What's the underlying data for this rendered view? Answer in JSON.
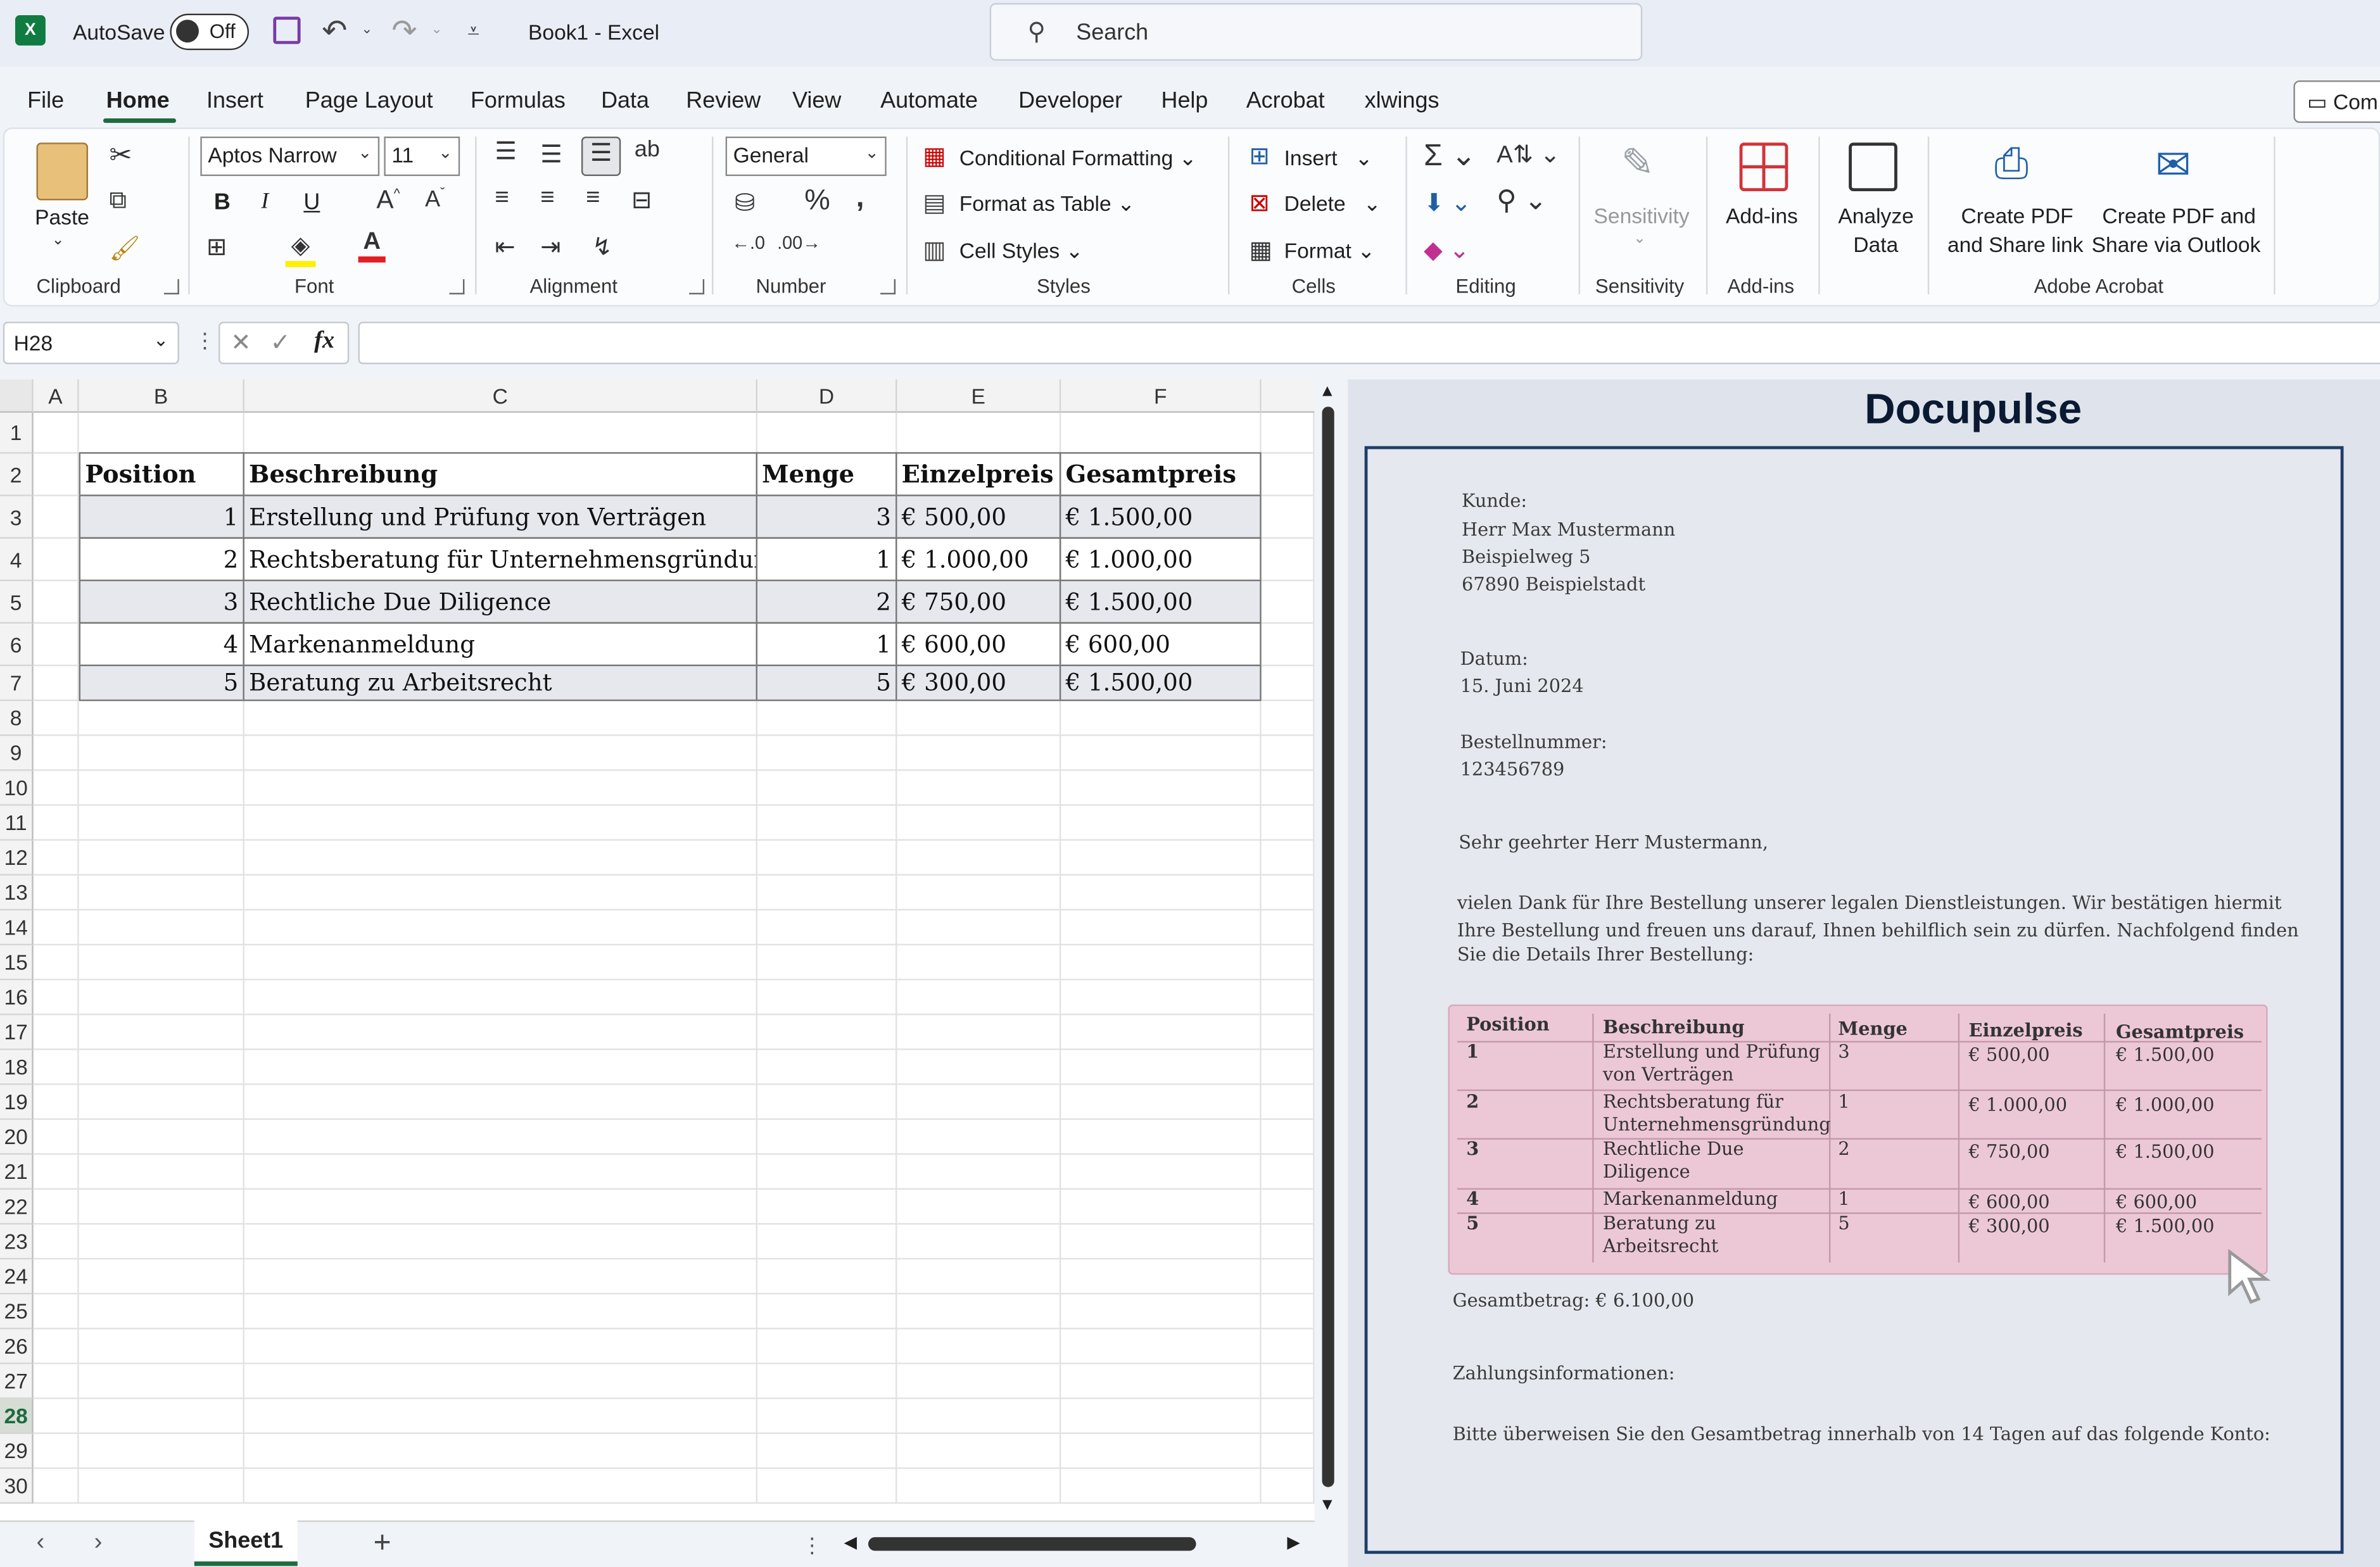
{
  "window": {
    "title": "Book1  -  Excel",
    "autosave_label": "AutoSave",
    "autosave_state": "Off",
    "search_placeholder": "Search"
  },
  "menu": [
    "File",
    "Home",
    "Insert",
    "Page Layout",
    "Formulas",
    "Data",
    "Review",
    "View",
    "Automate",
    "Developer",
    "Help",
    "Acrobat",
    "xlwings"
  ],
  "comments_button": "Com",
  "ribbon": {
    "clipboard": {
      "paste": "Paste",
      "label": "Clipboard"
    },
    "font": {
      "name": "Aptos Narrow",
      "size": "11",
      "label": "Font",
      "bold": "B",
      "italic": "I",
      "underline": "U"
    },
    "alignment": {
      "label": "Alignment"
    },
    "number": {
      "format": "General",
      "label": "Number"
    },
    "styles": {
      "conditional": "Conditional Formatting",
      "table": "Format as Table",
      "cell_styles": "Cell Styles",
      "label": "Styles"
    },
    "cells": {
      "insert": "Insert",
      "delete": "Delete",
      "format": "Format",
      "label": "Cells"
    },
    "editing": {
      "label": "Editing"
    },
    "sensitivity": {
      "button": "Sensitivity",
      "label": "Sensitivity"
    },
    "addins": {
      "button": "Add-ins",
      "label": "Add-ins"
    },
    "analyze": {
      "line1": "Analyze",
      "line2": "Data"
    },
    "acrobat": {
      "pdf1_line1": "Create PDF",
      "pdf1_line2": "and Share link",
      "pdf2_line1": "Create PDF and",
      "pdf2_line2": "Share via Outlook",
      "label": "Adobe Acrobat"
    }
  },
  "formula_bar": {
    "name_box": "H28",
    "fx": "fx",
    "content": ""
  },
  "sheet": {
    "columns": [
      "A",
      "B",
      "C",
      "D",
      "E",
      "F"
    ],
    "rows": [
      "1",
      "2",
      "3",
      "4",
      "5",
      "6",
      "7",
      "8",
      "9",
      "10",
      "11",
      "12",
      "13",
      "14",
      "15",
      "16",
      "17",
      "18",
      "19",
      "20",
      "21",
      "22",
      "23",
      "24",
      "25",
      "26",
      "27",
      "28",
      "29",
      "30"
    ],
    "selected_row": "28",
    "table": {
      "headers": [
        "Position",
        "Beschreibung",
        "Menge",
        "Einzelpreis",
        "Gesamtpreis"
      ],
      "rows": [
        [
          "1",
          "Erstellung und Prüfung von Verträgen",
          "3",
          "€ 500,00",
          "€ 1.500,00"
        ],
        [
          "2",
          "Rechtsberatung für Unternehmensgründung",
          "1",
          "€ 1.000,00",
          "€ 1.000,00"
        ],
        [
          "3",
          "Rechtliche Due Diligence",
          "2",
          "€ 750,00",
          "€ 1.500,00"
        ],
        [
          "4",
          "Markenanmeldung",
          "1",
          "€ 600,00",
          "€ 600,00"
        ],
        [
          "5",
          "Beratung zu Arbeitsrecht",
          "5",
          "€ 300,00",
          "€ 1.500,00"
        ]
      ]
    },
    "tab": "Sheet1"
  },
  "preview": {
    "title": "Docupulse",
    "kunde_label": "Kunde:",
    "kunde": [
      "Herr Max Mustermann",
      "Beispielweg 5",
      "67890 Beispielstadt"
    ],
    "datum_label": "Datum:",
    "datum": "15. Juni 2024",
    "bestell_label": "Bestellnummer:",
    "bestell": "123456789",
    "greeting": "Sehr geehrter Herr Mustermann,",
    "body": [
      "vielen Dank für Ihre Bestellung unserer legalen Dienstleistungen. Wir bestätigen hiermit",
      "Ihre Bestellung und freuen uns darauf, Ihnen behilflich sein zu dürfen. Nachfolgend finden",
      "Sie die Details Ihrer Bestellung:"
    ],
    "table_headers": [
      "Position",
      "Beschreibung",
      "Menge",
      "Einzelpreis",
      "Gesamtpreis"
    ],
    "table_rows": [
      [
        "1",
        "Erstellung und Prüfung\nvon Verträgen",
        "3",
        "€ 500,00",
        "€ 1.500,00"
      ],
      [
        "2",
        "Rechtsberatung für\nUnternehmensgründung",
        "1",
        "€ 1.000,00",
        "€ 1.000,00"
      ],
      [
        "3",
        "Rechtliche Due\nDiligence",
        "2",
        "€ 750,00",
        "€ 1.500,00"
      ],
      [
        "4",
        "Markenanmeldung",
        "1",
        "€ 600,00",
        "€ 600,00"
      ],
      [
        "5",
        "Beratung zu\nArbeitsrecht",
        "5",
        "€ 300,00",
        "€ 1.500,00"
      ]
    ],
    "total": "Gesamtbetrag: € 6.100,00",
    "payment_label": "Zahlungsinformationen:",
    "payment_text": "Bitte überweisen Sie den Gesamtbetrag innerhalb von 14 Tagen auf das folgende Konto:"
  },
  "colors": {
    "excel_green": "#107c41",
    "doc_frame": "#1f3d66",
    "table_pink": "#ecc8d6"
  }
}
